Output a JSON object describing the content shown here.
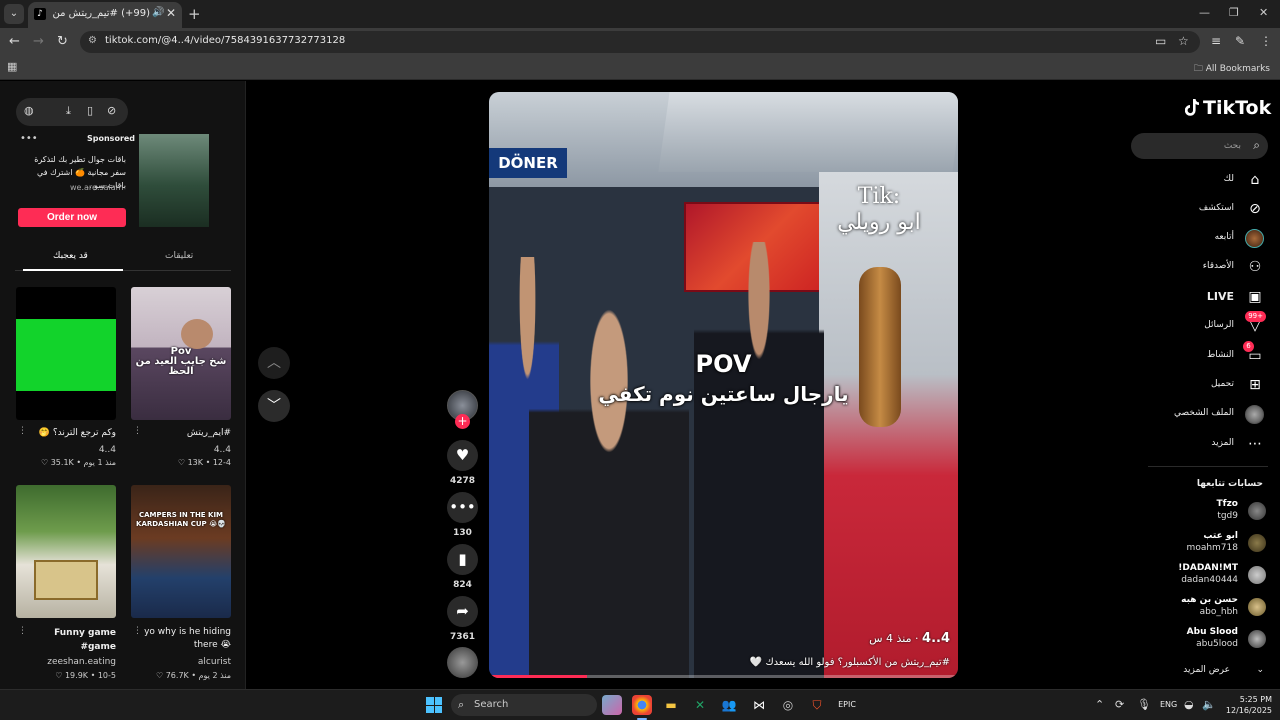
{
  "browser": {
    "tab_title": "(99+) #تيم_ريتش من الأكسبلور",
    "url": "tiktok.com/@4..4/video/7584391637732773128",
    "bookmarks_label": "All Bookmarks"
  },
  "left_panel": {
    "ad": {
      "sponsored": "Sponsored",
      "text": "باقات جوال تطير بك لتذكرة سفر مجانية 🍊 اشترك في باقات سو...",
      "domain": "we.are.salam",
      "cta": "Order now"
    },
    "tabs": [
      "قد يعجبك",
      "تعليقات"
    ],
    "cards": [
      {
        "title": "#ايم_ريتش",
        "author": "4..4",
        "views": "13K",
        "date": "12-4",
        "thumb_text": "Pov\nشخ جايب العيد من الحظ"
      },
      {
        "title": "وكم ترجع الترند؟ 🤭",
        "author": "4..4",
        "views": "35.1K",
        "date": "منذ 1 يوم",
        "thumb_text": ""
      },
      {
        "title": "yo why is he hiding there 😭",
        "author": "alcurist",
        "views": "76.7K",
        "date": "منذ 2 يوم",
        "thumb_text": "CAMPERS IN THE KIM KARDASHIAN CUP 😭💀"
      },
      {
        "title": "Funny game #game",
        "author": "zeeshan.eating",
        "views": "19.9K",
        "date": "10-5",
        "thumb_text": ""
      }
    ]
  },
  "video": {
    "overlay_pov": "POV",
    "overlay_line": "يارجال ساعتين نوم تكفي",
    "tik": "Tik:",
    "tik_name": "ابو رويلي",
    "sign": "DÖNER",
    "author": "4..4",
    "time_ago": "منذ 4 س",
    "caption": "#تيم_ريتش من الأكسبلور؟ فولو الله يسعدك 🤍",
    "progress": 0.21,
    "likes": "4278",
    "comments": "130",
    "saves": "824",
    "shares": "7361"
  },
  "sidebar": {
    "brand": "TikTok",
    "search_placeholder": "بحث",
    "nav": [
      {
        "label": "لك",
        "icon": "home-icon"
      },
      {
        "label": "استكشف",
        "icon": "compass-icon"
      },
      {
        "label": "أتابعه",
        "icon": "avatar"
      },
      {
        "label": "الأصدقاء",
        "icon": "friends-icon"
      },
      {
        "label": "LIVE",
        "icon": "live-icon"
      },
      {
        "label": "الرسائل",
        "icon": "messages-icon",
        "badge": "99+"
      },
      {
        "label": "النشاط",
        "icon": "activity-icon",
        "badge": "6"
      },
      {
        "label": "تحميل",
        "icon": "upload-icon"
      },
      {
        "label": "الملف الشخصي",
        "icon": "profile-avatar"
      },
      {
        "label": "المزيد",
        "icon": "more-icon"
      }
    ],
    "following_title": "حسابات تتابعها",
    "accounts": [
      {
        "name": "Tfzo",
        "handle": "tgd9"
      },
      {
        "name": "ابو عتب",
        "handle": "moahm718"
      },
      {
        "name": "!DADAN!MT",
        "handle": "dadan40444"
      },
      {
        "name": "حسن بن هبه",
        "handle": "abo_hbh"
      },
      {
        "name": "Abu Slood",
        "handle": "abu5lood"
      }
    ],
    "see_more": "عرض المزيد"
  },
  "taskbar": {
    "search_label": "Search",
    "lang": "ENG",
    "time": "5:25 PM",
    "date": "12/16/2025"
  }
}
